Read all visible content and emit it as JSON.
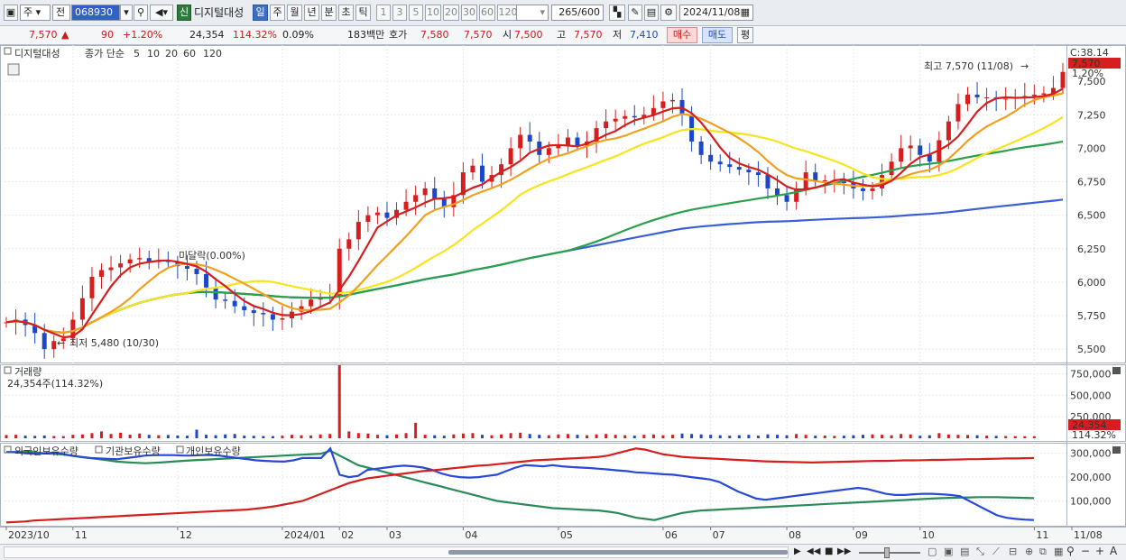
{
  "toolbar": {
    "market": "주",
    "market2": "전",
    "code": "068930",
    "credit": "신",
    "name": "디지털대성",
    "periods": [
      "일",
      "주",
      "월",
      "년",
      "분",
      "초",
      "틱"
    ],
    "active_period": "일",
    "minutes": [
      "1",
      "3",
      "5",
      "10",
      "20",
      "30",
      "60",
      "120"
    ],
    "count": "265",
    "count_total": "/600",
    "date": "2024/11/08"
  },
  "quote": {
    "price": "7,570",
    "change_arrow": "▲",
    "change": "90",
    "change_pct": "+1.20%",
    "volume": "24,354",
    "vol_ratio": "114.32%",
    "turnover": "0.09%",
    "amount": "183백만",
    "ask_label": "호가",
    "ask": "7,580",
    "bid": "7,570",
    "open_label": "시",
    "open": "7,500",
    "high_label": "고",
    "high": "7,570",
    "low_label": "저",
    "low": "7,410",
    "buy": "매수",
    "sell": "매도",
    "avg": "평"
  },
  "chart_data": {
    "type": "line",
    "title": "디지털대성",
    "legend": {
      "price_label": "종가 단순",
      "ma_periods": [
        "5",
        "10",
        "20",
        "60",
        "120"
      ],
      "ma_colors": [
        "#d61e1e",
        "#f0a020",
        "#f6e51e",
        "#2aa04a",
        "#3a5fd8"
      ]
    },
    "x_labels": [
      "2023/10",
      "11",
      "12",
      "2024/01",
      "02",
      "03",
      "04",
      "05",
      "06",
      "07",
      "08",
      "09",
      "10",
      "11",
      "11/08"
    ],
    "price_axis": [
      "7,500",
      "7,250",
      "7,000",
      "6,750",
      "6,500",
      "6,250",
      "6,000",
      "5,750",
      "5,500"
    ],
    "price_range": [
      5400,
      7750
    ],
    "top_right_label": "C:38.14",
    "current_price_label": "7,570",
    "current_pct_label": "1.20%",
    "annotations": {
      "high": "최고 7,570 (11/08)",
      "low": "최저 5,480 (10/30)",
      "mid": "미달락(0.00%)"
    },
    "close_series": [
      5700,
      5720,
      5680,
      5620,
      5500,
      5560,
      5580,
      5720,
      5880,
      6040,
      6090,
      6110,
      6140,
      6170,
      6180,
      6150,
      6160,
      6150,
      6120,
      6100,
      6060,
      5960,
      5870,
      5860,
      5820,
      5790,
      5770,
      5760,
      5720,
      5730,
      5780,
      5820,
      5870,
      5880,
      5890,
      6250,
      6320,
      6450,
      6500,
      6520,
      6480,
      6540,
      6600,
      6650,
      6700,
      6620,
      6560,
      6650,
      6820,
      6870,
      6750,
      6800,
      6880,
      7000,
      7100,
      7050,
      6950,
      7000,
      7020,
      7080,
      7020,
      7050,
      7150,
      7200,
      7220,
      7240,
      7230,
      7250,
      7300,
      7350,
      7360,
      7250,
      7050,
      6950,
      6900,
      6880,
      6860,
      6840,
      6820,
      6800,
      6700,
      6650,
      6600,
      6700,
      6820,
      6760,
      6760,
      6760,
      6740,
      6700,
      6680,
      6700,
      6800,
      6900,
      7000,
      7020,
      6950,
      6900,
      7060,
      7200,
      7330,
      7400,
      7380,
      7380,
      7370,
      7370,
      7380,
      7390,
      7400,
      7410,
      7450,
      7570
    ],
    "volume_panel": {
      "title": "거래량",
      "current": "24,354주(114.32%)",
      "axis": [
        "750,000",
        "500,000",
        "250,000"
      ],
      "max": 850000,
      "current_label": "24,354",
      "current_pct_label": "114.32%",
      "series": [
        38000,
        40000,
        30000,
        28000,
        32000,
        26000,
        25000,
        40000,
        45000,
        60000,
        80000,
        50000,
        65000,
        42000,
        55000,
        40000,
        35000,
        38000,
        32000,
        30000,
        100000,
        40000,
        35000,
        45000,
        50000,
        30000,
        28000,
        26000,
        25000,
        30000,
        40000,
        35000,
        32000,
        45000,
        50000,
        850000,
        80000,
        60000,
        55000,
        40000,
        35000,
        45000,
        60000,
        180000,
        40000,
        35000,
        30000,
        45000,
        55000,
        60000,
        40000,
        35000,
        45000,
        60000,
        65000,
        50000,
        40000,
        35000,
        45000,
        50000,
        40000,
        35000,
        45000,
        50000,
        40000,
        35000,
        30000,
        40000,
        45000,
        35000,
        40000,
        55000,
        50000,
        45000,
        40000,
        35000,
        30000,
        35000,
        40000,
        30000,
        45000,
        40000,
        35000,
        50000,
        40000,
        30000,
        32000,
        28000,
        30000,
        35000,
        40000,
        45000,
        40000,
        35000,
        50000,
        45000,
        30000,
        35000,
        60000,
        45000,
        40000,
        38000,
        35000,
        30000,
        28000,
        26000,
        25000,
        24000,
        24354
      ]
    },
    "holdings_panel": {
      "legend": [
        "외국인보유수량",
        "기관보유수량",
        "개인보유수량"
      ],
      "legend_colors": [
        "#d61e1e",
        "#2848d8",
        "#2a8a58"
      ],
      "axis": [
        "300,000",
        "200,000",
        "100,000"
      ],
      "max": 340000,
      "foreign": [
        10000,
        12000,
        14000,
        18000,
        20000,
        22000,
        24000,
        26000,
        28000,
        30000,
        32000,
        34000,
        36000,
        38000,
        40000,
        42000,
        44000,
        46000,
        48000,
        50000,
        52000,
        54000,
        56000,
        58000,
        60000,
        62000,
        64000,
        68000,
        72000,
        78000,
        85000,
        92000,
        100000,
        115000,
        130000,
        145000,
        160000,
        175000,
        185000,
        195000,
        200000,
        205000,
        210000,
        215000,
        220000,
        225000,
        228000,
        232000,
        236000,
        240000,
        244000,
        248000,
        250000,
        254000,
        258000,
        262000,
        266000,
        270000,
        272000,
        274000,
        276000,
        278000,
        280000,
        282000,
        285000,
        290000,
        300000,
        310000,
        320000,
        315000,
        305000,
        295000,
        290000,
        285000,
        282000,
        280000,
        278000,
        276000,
        274000,
        272000,
        270000,
        268000,
        266000,
        265000,
        264000,
        263000,
        262000,
        261000,
        262000,
        263000,
        264000,
        265000,
        266000,
        267000,
        268000,
        268000,
        269000,
        270000,
        270000,
        271000,
        272000,
        272000,
        273000,
        274000,
        275000,
        275000,
        276000,
        277000,
        278000,
        278000,
        279000,
        280000
      ],
      "institution": [
        305000,
        305000,
        300000,
        298000,
        300000,
        302000,
        298000,
        290000,
        285000,
        280000,
        278000,
        276000,
        275000,
        280000,
        285000,
        290000,
        292000,
        292000,
        292000,
        290000,
        290000,
        292000,
        292000,
        290000,
        285000,
        280000,
        275000,
        270000,
        268000,
        266000,
        265000,
        270000,
        280000,
        280000,
        280000,
        320000,
        210000,
        200000,
        205000,
        230000,
        235000,
        240000,
        245000,
        248000,
        245000,
        240000,
        230000,
        215000,
        205000,
        200000,
        198000,
        200000,
        205000,
        210000,
        225000,
        240000,
        250000,
        248000,
        245000,
        250000,
        245000,
        242000,
        240000,
        238000,
        235000,
        232000,
        228000,
        225000,
        220000,
        218000,
        215000,
        212000,
        210000,
        205000,
        200000,
        195000,
        190000,
        180000,
        160000,
        140000,
        125000,
        110000,
        105000,
        110000,
        115000,
        120000,
        125000,
        130000,
        135000,
        140000,
        145000,
        150000,
        155000,
        150000,
        140000,
        130000,
        125000,
        125000,
        128000,
        130000,
        130000,
        128000,
        125000,
        120000,
        100000,
        80000,
        60000,
        40000,
        30000,
        25000,
        22000,
        20000
      ],
      "individual": [
        305000,
        305000,
        308000,
        305000,
        300000,
        298000,
        295000,
        290000,
        285000,
        280000,
        275000,
        270000,
        265000,
        262000,
        260000,
        258000,
        260000,
        262000,
        265000,
        268000,
        270000,
        272000,
        274000,
        276000,
        278000,
        280000,
        282000,
        284000,
        286000,
        288000,
        290000,
        292000,
        294000,
        296000,
        298000,
        310000,
        290000,
        270000,
        250000,
        240000,
        230000,
        220000,
        210000,
        200000,
        190000,
        180000,
        170000,
        160000,
        150000,
        140000,
        130000,
        120000,
        110000,
        100000,
        95000,
        90000,
        85000,
        80000,
        75000,
        70000,
        68000,
        66000,
        64000,
        62000,
        60000,
        55000,
        50000,
        40000,
        30000,
        25000,
        20000,
        30000,
        40000,
        50000,
        55000,
        60000,
        62000,
        64000,
        66000,
        68000,
        70000,
        72000,
        74000,
        76000,
        78000,
        80000,
        82000,
        84000,
        86000,
        88000,
        90000,
        92000,
        94000,
        96000,
        98000,
        100000,
        102000,
        104000,
        106000,
        108000,
        110000,
        112000,
        113000,
        114000,
        115000,
        116000,
        116000,
        116000,
        115000,
        114000,
        113000,
        112000
      ]
    }
  }
}
